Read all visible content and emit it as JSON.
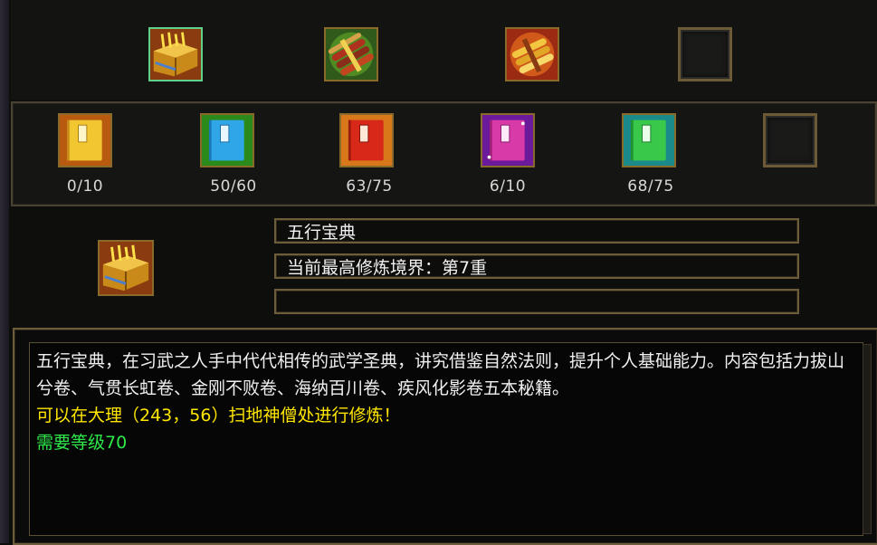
{
  "top_row": [
    {
      "icon": "yellow-tome-icon",
      "selected": true
    },
    {
      "icon": "red-scroll-bundle-icon",
      "selected": false
    },
    {
      "icon": "gold-scroll-bundle-icon",
      "selected": false
    },
    {
      "icon": "empty-slot-icon",
      "selected": false
    }
  ],
  "books": [
    {
      "icon": "gold-manual-icon",
      "count": "0/10"
    },
    {
      "icon": "blue-manual-icon",
      "count": "50/60"
    },
    {
      "icon": "red-manual-icon",
      "count": "63/75"
    },
    {
      "icon": "purple-manual-icon",
      "count": "6/10"
    },
    {
      "icon": "green-manual-icon",
      "count": "68/75"
    },
    {
      "icon": "empty-slot-icon",
      "count": ""
    }
  ],
  "detail": {
    "name": "五行宝典",
    "realm": "当前最高修炼境界：第7重",
    "extra": ""
  },
  "description": {
    "line1": "五行宝典，在习武之人手中代代相传的武学圣典，讲究借鉴自然法则，提升个人基础能力。内容包括力拔山兮卷、气贯长虹卷、金刚不败卷、海纳百川卷、疾风化影卷五本秘籍。",
    "location": "可以在大理（243，56）扫地神僧处进行修炼！",
    "level_req": "需要等级70"
  },
  "colors": {
    "frame": "#6d5d3b",
    "location_text": "#ffe600",
    "level_text": "#2ee84a"
  }
}
